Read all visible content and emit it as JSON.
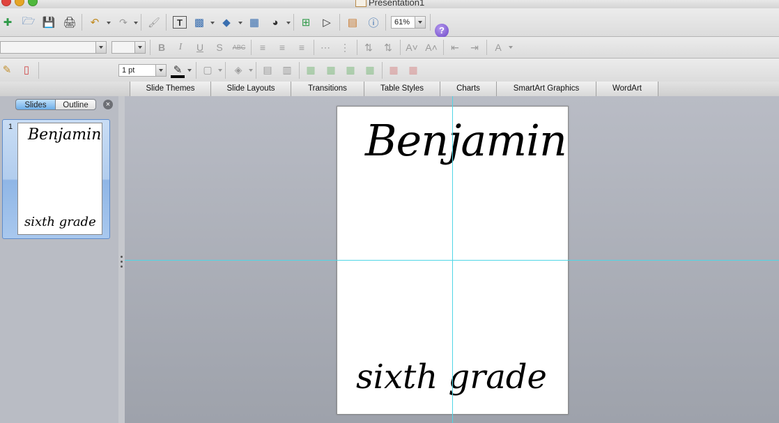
{
  "window": {
    "title": "Presentation1"
  },
  "toolbar": {
    "zoom": "61%",
    "line_weight": "1 pt",
    "font_name": "",
    "font_size": "",
    "help_label": "?"
  },
  "icons": {
    "new": "new-document-icon",
    "templates": "templates-icon",
    "save": "save-icon",
    "print": "print-icon",
    "undo": "undo-icon",
    "redo": "redo-icon",
    "format_painter": "format-painter-icon",
    "textbox": "text-box-icon",
    "picture": "picture-icon",
    "shapes": "shapes-icon",
    "table": "table-icon",
    "media": "media-icon",
    "new_slide": "new-slide-icon",
    "slideshow": "slide-show-icon",
    "gallery": "gallery-icon",
    "toolbox": "toolbox-icon"
  },
  "format_bar": {
    "bold": "B",
    "italic": "I",
    "underline": "U",
    "shadow": "S",
    "strikethrough": "ABC",
    "font_color": "A"
  },
  "ribbon": {
    "tabs": [
      "Slide Themes",
      "Slide Layouts",
      "Transitions",
      "Table Styles",
      "Charts",
      "SmartArt Graphics",
      "WordArt"
    ]
  },
  "slides_pane": {
    "tab_slides": "Slides",
    "tab_outline": "Outline",
    "close_label": "×",
    "thumbnails": [
      {
        "number": "1",
        "title": "Benjamin",
        "subtitle": "sixth grade"
      }
    ]
  },
  "slide": {
    "title": "Benjamin",
    "subtitle": "sixth grade"
  },
  "colors": {
    "accent": "#6eaee8",
    "guide": "#50d6e6",
    "canvas": "#b0b3bc"
  }
}
